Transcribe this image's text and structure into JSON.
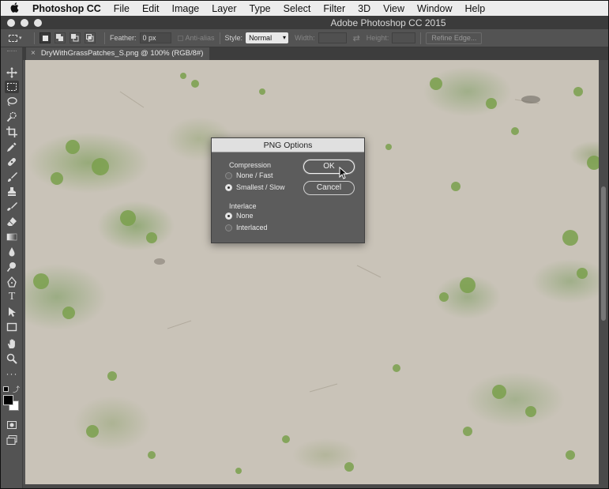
{
  "menubar": {
    "apple_icon": "apple-icon",
    "app_name": "Photoshop CC",
    "items": [
      "File",
      "Edit",
      "Image",
      "Layer",
      "Type",
      "Select",
      "Filter",
      "3D",
      "View",
      "Window",
      "Help"
    ]
  },
  "window": {
    "title": "Adobe Photoshop CC 2015"
  },
  "options": {
    "feather_label": "Feather:",
    "feather_value": "0 px",
    "antialias_label": "Anti-alias",
    "style_label": "Style:",
    "style_value": "Normal",
    "width_label": "Width:",
    "height_label": "Height:",
    "refine_label": "Refine Edge..."
  },
  "document": {
    "tab_label": "DryWithGrassPatches_S.png @ 100% (RGB/8#)",
    "close_glyph": "×"
  },
  "dialog": {
    "title": "PNG Options",
    "compression_label": "Compression",
    "compression_options": [
      "None / Fast",
      "Smallest / Slow"
    ],
    "compression_selected": "Smallest / Slow",
    "interlace_label": "Interlace",
    "interlace_options": [
      "None",
      "Interlaced"
    ],
    "interlace_selected": "None",
    "ok_label": "OK",
    "cancel_label": "Cancel"
  },
  "colors": {
    "menubar_bg": "#ececec",
    "panel_bg": "#535353",
    "dialog_bg": "#5c5c5c",
    "canvas_dirt": "#c9c3b8",
    "grass": "#6f9646"
  },
  "tools": [
    "move-icon",
    "marquee-icon",
    "lasso-icon",
    "quick-select-icon",
    "crop-icon",
    "eyedropper-icon",
    "healing-brush-icon",
    "brush-icon",
    "clone-stamp-icon",
    "history-brush-icon",
    "eraser-icon",
    "gradient-icon",
    "blur-icon",
    "dodge-icon",
    "pen-icon",
    "type-icon",
    "path-select-icon",
    "rectangle-icon",
    "hand-icon",
    "zoom-icon",
    "more-tools-icon"
  ]
}
